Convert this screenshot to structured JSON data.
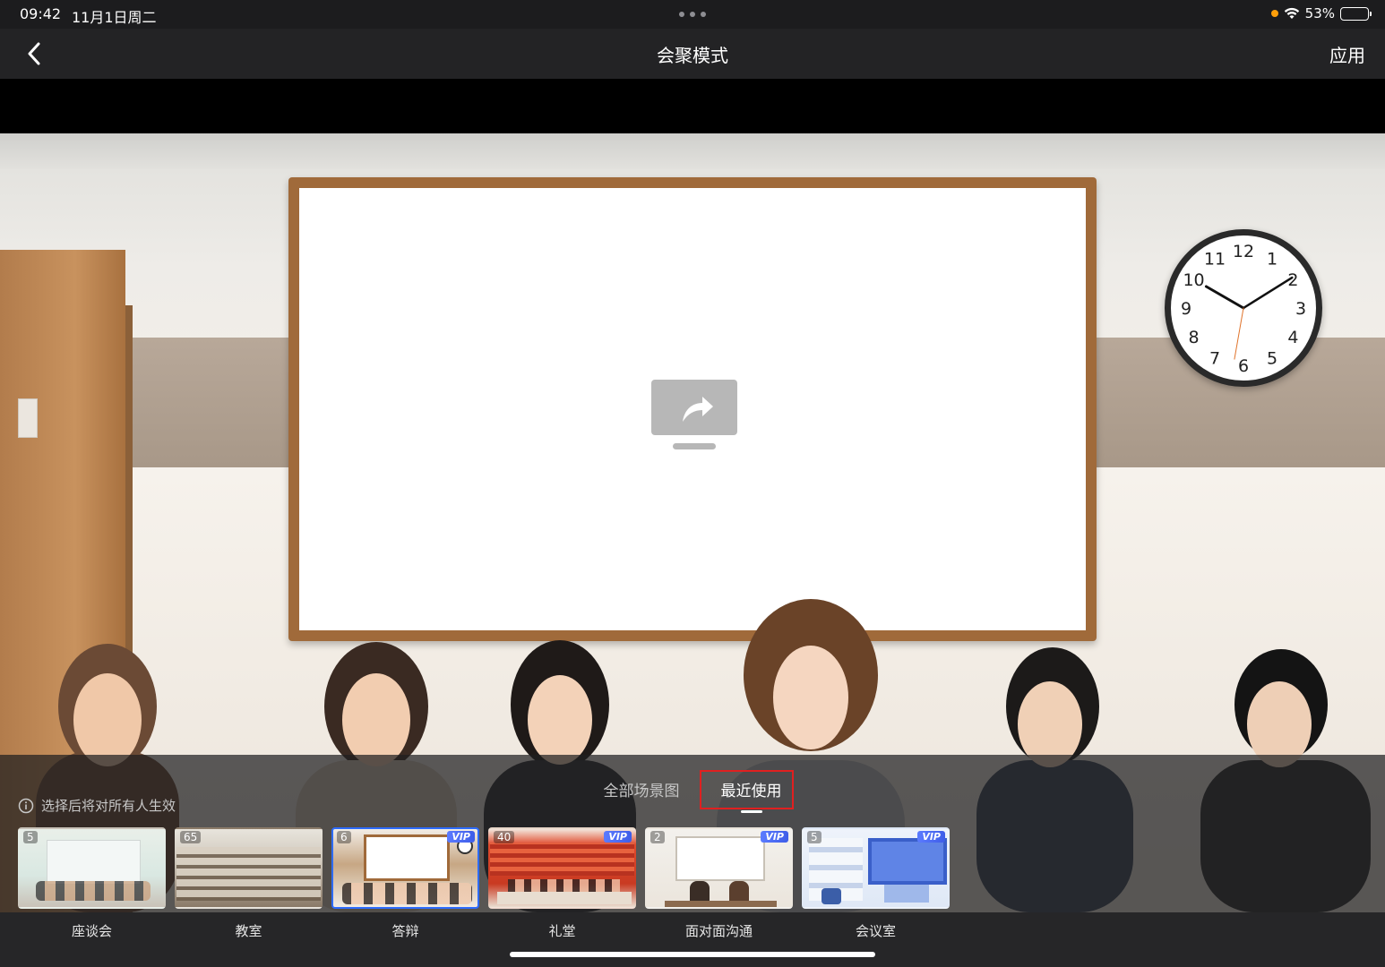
{
  "status_bar": {
    "time": "09:42",
    "date": "11月1日周二",
    "battery": "53%",
    "battery_level": 0.53
  },
  "nav": {
    "title": "会聚模式",
    "apply_label": "应用"
  },
  "scene": {
    "clock_numbers": [
      "12",
      "1",
      "2",
      "3",
      "4",
      "5",
      "6",
      "7",
      "8",
      "9",
      "10",
      "11"
    ]
  },
  "panel": {
    "hint": "选择后将对所有人生效",
    "tabs": [
      {
        "label": "全部场景图",
        "active": false
      },
      {
        "label": "最近使用",
        "active": true
      }
    ],
    "thumbnails": [
      {
        "label": "座谈会",
        "count": "5",
        "vip": "",
        "selected": false
      },
      {
        "label": "教室",
        "count": "65",
        "vip": "",
        "selected": false
      },
      {
        "label": "答辩",
        "count": "6",
        "vip": "VIP",
        "selected": true
      },
      {
        "label": "礼堂",
        "count": "40",
        "vip": "VIP",
        "selected": false
      },
      {
        "label": "面对面沟通",
        "count": "2",
        "vip": "VIP",
        "selected": false
      },
      {
        "label": "会议室",
        "count": "5",
        "vip": "VIP",
        "selected": false
      }
    ]
  },
  "colors": {
    "accent": "#2d6bff",
    "highlight": "#e02020",
    "status_dot": "#ff9f0a"
  }
}
